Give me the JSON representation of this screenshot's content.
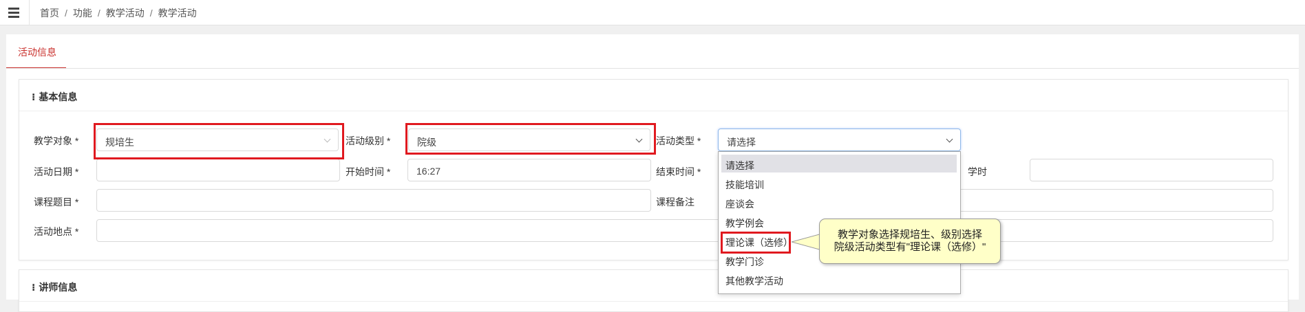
{
  "breadcrumb": {
    "items": [
      "首页",
      "功能",
      "教学活动",
      "教学活动"
    ],
    "separator": "/"
  },
  "tab": {
    "label": "活动信息"
  },
  "basic_info": {
    "title": "基本信息",
    "labels": {
      "teaching_object": "教学对象 *",
      "activity_level": "活动级别 *",
      "activity_type": "活动类型 *",
      "activity_date": "活动日期 *",
      "start_time": "开始时间 *",
      "end_time": "结束时间 *",
      "hours": "学时",
      "course_title": "课程题目 *",
      "course_note": "课程备注",
      "location": "活动地点 *"
    },
    "values": {
      "teaching_object": "规培生",
      "activity_level": "院级",
      "activity_type": "请选择",
      "activity_date": "",
      "start_time": "16:27",
      "end_time": "",
      "hours": "",
      "course_title": "",
      "course_note": "",
      "location": ""
    }
  },
  "activity_type_options": [
    "请选择",
    "技能培训",
    "座谈会",
    "教学例会",
    "理论课（选修）",
    "教学门诊",
    "其他教学活动"
  ],
  "selected_option": "请选择",
  "highlighted_option": "理论课（选修）",
  "callout": {
    "line1": "教学对象选择规培生、级别选择",
    "line2": "院级活动类型有\"理论课（选修）\""
  },
  "lecturer_info": {
    "title": "讲师信息"
  },
  "colors": {
    "accent": "#c9302c",
    "highlight_border": "#e0191f",
    "callout_bg": "#ffffc8"
  }
}
